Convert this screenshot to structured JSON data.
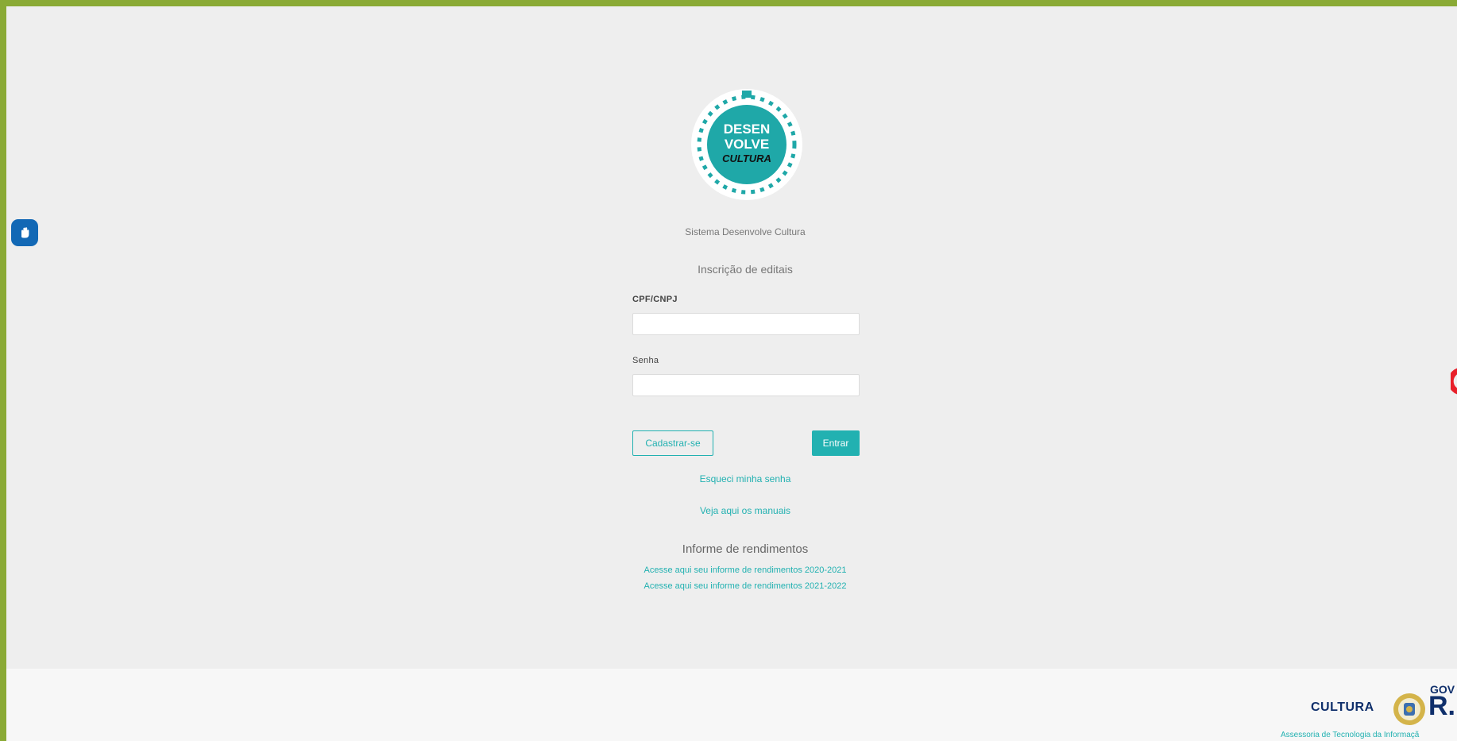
{
  "brand": {
    "logo_line1": "DESEN",
    "logo_line2": "VOLVE",
    "logo_line3": "CULTURA",
    "system_title": "Sistema Desenvolve Cultura"
  },
  "login": {
    "subtitle": "Inscrição de editais",
    "cpf_label": "CPF/CNPJ",
    "cpf_value": "",
    "cpf_placeholder": "",
    "password_label": "Senha",
    "password_value": "",
    "password_placeholder": "",
    "register_label": "Cadastrar-se",
    "submit_label": "Entrar",
    "forgot_link": "Esqueci minha senha",
    "manuals_link": "Veja aqui os manuais"
  },
  "income": {
    "title": "Informe de rendimentos",
    "link_2020": "Acesse aqui seu informe de rendimentos 2020-2021",
    "link_2021": "Acesse aqui seu informe de rendimentos 2021-2022"
  },
  "footer": {
    "cultura": "CULTURA",
    "gov": "GOV",
    "rj": "R.",
    "credit": "Assessoria de Tecnologia da Informaçã"
  },
  "colors": {
    "outer_frame": "#8aaa35",
    "background": "#eeeeee",
    "accent": "#22b1b1",
    "logo_teal": "#1fa8a8",
    "footer_navy": "#0f2f6b",
    "accessibility_blue": "#1268b5"
  },
  "icons": {
    "accessibility": "accessibility-hand-icon",
    "recaptcha": "recaptcha-icon",
    "seal": "state-seal-icon"
  }
}
